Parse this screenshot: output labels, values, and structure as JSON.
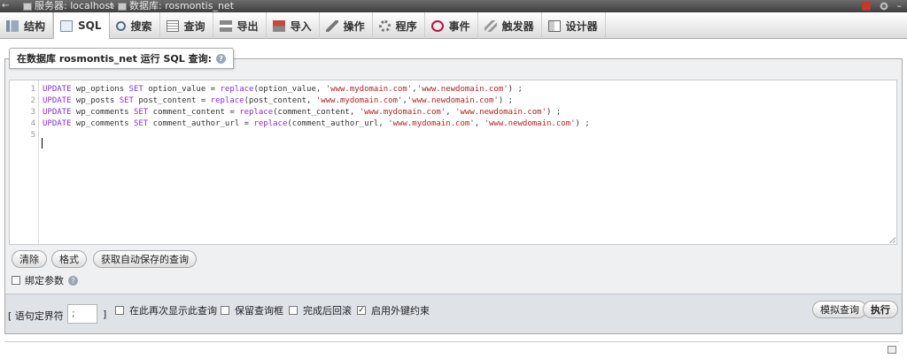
{
  "breadcrumb": {
    "hide_label": "←",
    "server_label": "服务器: localhost",
    "separator": "»",
    "database_label": "数据库: rosmontis_net"
  },
  "tabs": [
    {
      "label": "结构",
      "icon": "structure-icon"
    },
    {
      "label": "SQL",
      "icon": "sql-icon",
      "active": true
    },
    {
      "label": "搜索",
      "icon": "search-icon"
    },
    {
      "label": "查询",
      "icon": "query-icon"
    },
    {
      "label": "导出",
      "icon": "export-icon"
    },
    {
      "label": "导入",
      "icon": "import-icon"
    },
    {
      "label": "操作",
      "icon": "operations-icon"
    },
    {
      "label": "程序",
      "icon": "routines-icon"
    },
    {
      "label": "事件",
      "icon": "events-icon"
    },
    {
      "label": "触发器",
      "icon": "triggers-icon"
    },
    {
      "label": "设计器",
      "icon": "designer-icon"
    }
  ],
  "query_panel": {
    "legend": "在数据库 rosmontis_net 运行 SQL 查询:"
  },
  "editor": {
    "line_numbers": [
      "1",
      "2",
      "3",
      "4",
      "5"
    ],
    "lines": [
      "UPDATE wp_options SET option_value = replace(option_value, 'www.mydomain.com','www.newdomain.com') ;",
      "UPDATE wp_posts SET post_content = replace(post_content, 'www.mydomain.com','www.newdomain.com') ;",
      "UPDATE wp_comments SET comment_content = replace(comment_content, 'www.mydomain.com', 'www.newdomain.com') ;",
      "UPDATE wp_comments SET comment_author_url = replace(comment_author_url, 'www.mydomain.com', 'www.newdomain.com') ;",
      ""
    ]
  },
  "buttons": {
    "clear": "清除",
    "format": "格式",
    "autosave": "获取自动保存的查询",
    "simulate": "模拟查询",
    "go": "执行"
  },
  "bind_params": {
    "label": "绑定参数",
    "checked": false
  },
  "bottom": {
    "delimiter_label": "[ 语句定界符",
    "delimiter_value": ";",
    "delimiter_close": "]",
    "options": [
      {
        "label": "在此再次显示此查询",
        "checked": false
      },
      {
        "label": "保留查询框",
        "checked": false
      },
      {
        "label": "完成后回滚",
        "checked": false
      },
      {
        "label": "启用外键约束",
        "checked": true
      }
    ]
  },
  "colors": {
    "keyword": "#8a2be2",
    "string": "#b22222",
    "panel_bg": "#eef0f2",
    "bottom_bg": "#dfe3e8"
  }
}
